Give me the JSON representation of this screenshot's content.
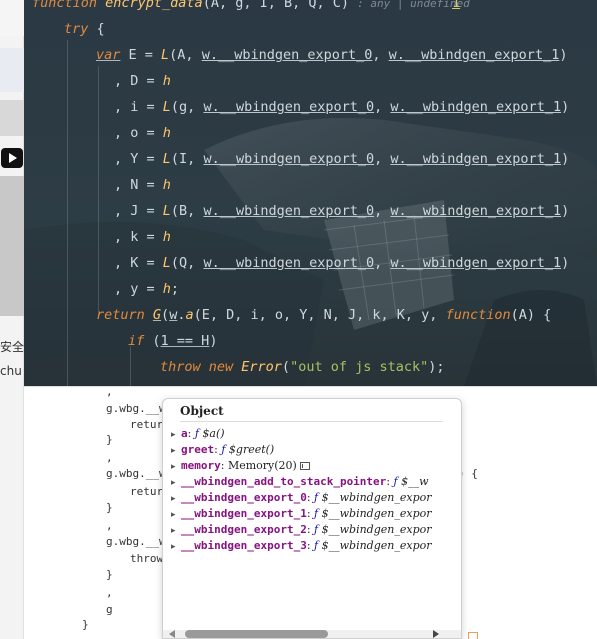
{
  "ide": {
    "lines": [
      {
        "id": "sig",
        "parts": [
          {
            "t": "function ",
            "c": "k"
          },
          {
            "t": "encrypt_data",
            "c": "fn"
          },
          {
            "t": "(A, g, I, B, Q, C) ",
            "c": "var"
          },
          {
            "t": ": any | undefined",
            "c": "hint"
          }
        ]
      },
      {
        "id": "try",
        "parts": [
          {
            "t": "try",
            "c": "k"
          },
          {
            "t": " {",
            "c": "var"
          }
        ]
      },
      {
        "id": "e",
        "parts": [
          {
            "t": "var",
            "c": "k ul"
          },
          {
            "t": " E = ",
            "c": "var"
          },
          {
            "t": "L",
            "c": "fn"
          },
          {
            "t": "(A, ",
            "c": "var"
          },
          {
            "t": "w.__wbindgen_export_0",
            "c": "wb"
          },
          {
            "t": ", ",
            "c": "var"
          },
          {
            "t": "w.__wbindgen_export_1",
            "c": "wb"
          },
          {
            "t": ")",
            "c": "var"
          }
        ]
      },
      {
        "id": "d",
        "parts": [
          {
            "t": ", D = ",
            "c": "var"
          },
          {
            "t": "h",
            "c": "fn"
          }
        ]
      },
      {
        "id": "i",
        "parts": [
          {
            "t": ", i = ",
            "c": "var"
          },
          {
            "t": "L",
            "c": "fn"
          },
          {
            "t": "(g, ",
            "c": "var"
          },
          {
            "t": "w.__wbindgen_export_0",
            "c": "wb"
          },
          {
            "t": ", ",
            "c": "var"
          },
          {
            "t": "w.__wbindgen_export_1",
            "c": "wb"
          },
          {
            "t": ")",
            "c": "var"
          }
        ]
      },
      {
        "id": "o",
        "parts": [
          {
            "t": ", o = ",
            "c": "var"
          },
          {
            "t": "h",
            "c": "fn"
          }
        ]
      },
      {
        "id": "y1",
        "parts": [
          {
            "t": ", Y = ",
            "c": "var"
          },
          {
            "t": "L",
            "c": "fn"
          },
          {
            "t": "(I, ",
            "c": "var"
          },
          {
            "t": "w.__wbindgen_export_0",
            "c": "wb"
          },
          {
            "t": ", ",
            "c": "var"
          },
          {
            "t": "w.__wbindgen_export_1",
            "c": "wb"
          },
          {
            "t": ")",
            "c": "var"
          }
        ]
      },
      {
        "id": "n",
        "parts": [
          {
            "t": ", N = ",
            "c": "var"
          },
          {
            "t": "h",
            "c": "fn"
          }
        ]
      },
      {
        "id": "j",
        "parts": [
          {
            "t": ", J = ",
            "c": "var"
          },
          {
            "t": "L",
            "c": "fn"
          },
          {
            "t": "(B, ",
            "c": "var"
          },
          {
            "t": "w.__wbindgen_export_0",
            "c": "wb"
          },
          {
            "t": ", ",
            "c": "var"
          },
          {
            "t": "w.__wbindgen_export_1",
            "c": "wb"
          },
          {
            "t": ")",
            "c": "var"
          }
        ]
      },
      {
        "id": "k",
        "parts": [
          {
            "t": ", k = ",
            "c": "var"
          },
          {
            "t": "h",
            "c": "fn"
          }
        ]
      },
      {
        "id": "kk",
        "parts": [
          {
            "t": ", K = ",
            "c": "var"
          },
          {
            "t": "L",
            "c": "fn"
          },
          {
            "t": "(Q, ",
            "c": "var"
          },
          {
            "t": "w.__wbindgen_export_0",
            "c": "wb"
          },
          {
            "t": ", ",
            "c": "var"
          },
          {
            "t": "w.__wbindgen_export_1",
            "c": "wb"
          },
          {
            "t": ")",
            "c": "var"
          }
        ]
      },
      {
        "id": "yy",
        "parts": [
          {
            "t": ", y = ",
            "c": "var"
          },
          {
            "t": "h",
            "c": "fn"
          },
          {
            "t": ";",
            "c": "var"
          }
        ]
      },
      {
        "id": "ret",
        "parts": [
          {
            "t": "return ",
            "c": "k"
          },
          {
            "t": "G",
            "c": "fn ul"
          },
          {
            "t": "(",
            "c": "var"
          },
          {
            "t": "w",
            "c": "ul"
          },
          {
            "t": ".",
            "c": "var"
          },
          {
            "t": "a",
            "c": "fn"
          },
          {
            "t": "(E, D, i, o, Y, N, J, k, K, y, ",
            "c": "var"
          },
          {
            "t": "function",
            "c": "k"
          },
          {
            "t": "(A) {",
            "c": "var"
          }
        ]
      },
      {
        "id": "if",
        "parts": [
          {
            "t": "if",
            "c": "k"
          },
          {
            "t": " (",
            "c": "var"
          },
          {
            "t": "1 == H",
            "c": "ul"
          },
          {
            "t": ")",
            "c": "var"
          }
        ]
      },
      {
        "id": "throw",
        "parts": [
          {
            "t": "throw new ",
            "c": "k"
          },
          {
            "t": "Error",
            "c": "fn"
          },
          {
            "t": "(",
            "c": "var"
          },
          {
            "t": "\"out of js stack\"",
            "c": "s"
          },
          {
            "t": ");",
            "c": "var"
          }
        ]
      }
    ],
    "scroll_marker": "1"
  },
  "bg": {
    "strip_labels": [
      "安全",
      "chu"
    ],
    "code_lines": [
      ",",
      "g.wbg.__wb",
      "retur",
      "}",
      ",",
      "g.wbg.__wb",
      "retur",
      "}",
      ",",
      "g.wbg.__wb",
      "throw",
      "}",
      ",",
      "g",
      "}"
    ],
    "right_fragment": ") {"
  },
  "popover": {
    "title": "Object",
    "props": [
      {
        "key": "a",
        "fsym": "ƒ",
        "fval": "$a()"
      },
      {
        "key": "greet",
        "fsym": "ƒ",
        "fval": "$greet()"
      },
      {
        "key": "memory",
        "fsym": "",
        "fval": "Memory(20)",
        "icon": true
      },
      {
        "key": "__wbindgen_add_to_stack_pointer",
        "fsym": "ƒ",
        "fval": "$__w"
      },
      {
        "key": "__wbindgen_export_0",
        "fsym": "ƒ",
        "fval": "$__wbindgen_expor"
      },
      {
        "key": "__wbindgen_export_1",
        "fsym": "ƒ",
        "fval": "$__wbindgen_expor"
      },
      {
        "key": "__wbindgen_export_2",
        "fsym": "ƒ",
        "fval": "$__wbindgen_expor"
      },
      {
        "key": "__wbindgen_export_3",
        "fsym": "ƒ",
        "fval": "$__wbindgen_expor"
      }
    ]
  }
}
